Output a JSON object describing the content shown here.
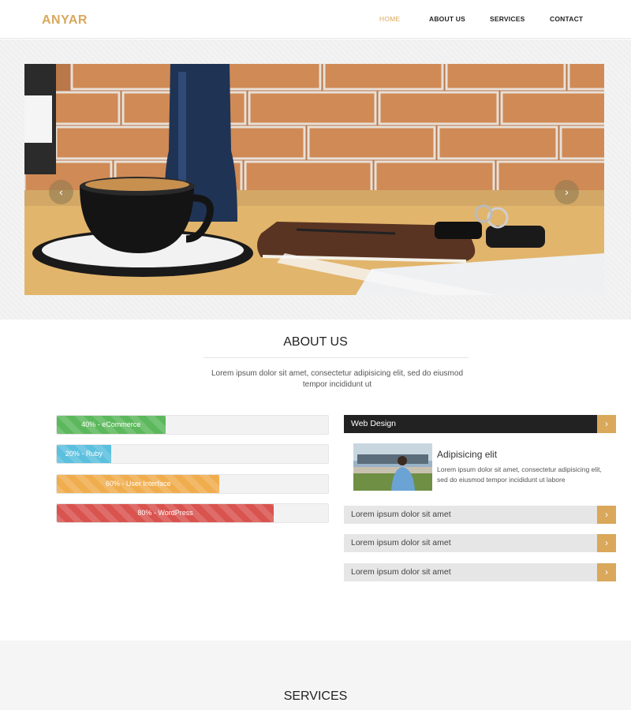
{
  "brand": {
    "logo": "ANYAR",
    "accent": "#d9a85b"
  },
  "nav": [
    {
      "label": "HOME",
      "active": true
    },
    {
      "label": "ABOUT US",
      "active": false
    },
    {
      "label": "SERVICES",
      "active": false
    },
    {
      "label": "CONTACT",
      "active": false
    }
  ],
  "slider": {
    "prev_icon": "chevron-left",
    "next_icon": "chevron-right",
    "prev": "‹",
    "next": "›"
  },
  "about": {
    "title": "ABOUT US",
    "description": "Lorem ipsum dolor sit amet, consectetur adipisicing elit, sed do eiusmod tempor incididunt ut"
  },
  "skills": [
    {
      "label": "40% - eCommerce",
      "percent": 40,
      "color": "#5cb85c"
    },
    {
      "label": "20% - Ruby",
      "percent": 20,
      "color": "#5bc0de"
    },
    {
      "label": "60% - User Interface",
      "percent": 60,
      "color": "#f0ad4e"
    },
    {
      "label": "80% - WordPress",
      "percent": 80,
      "color": "#d9534f"
    }
  ],
  "accordion": {
    "open": {
      "title": "Web Design",
      "body_title": "Adipisicing elit",
      "body_text": "Lorem ipsum dolor sit amet, consectetur adipisicing elit, sed do eiusmod tempor incididunt ut labore"
    },
    "items": [
      {
        "title": "Lorem ipsum dolor sit amet"
      },
      {
        "title": "Lorem ipsum dolor sit amet"
      },
      {
        "title": "Lorem ipsum dolor sit amet"
      }
    ],
    "toggle_icon": "›"
  },
  "services": {
    "title": "SERVICES"
  }
}
